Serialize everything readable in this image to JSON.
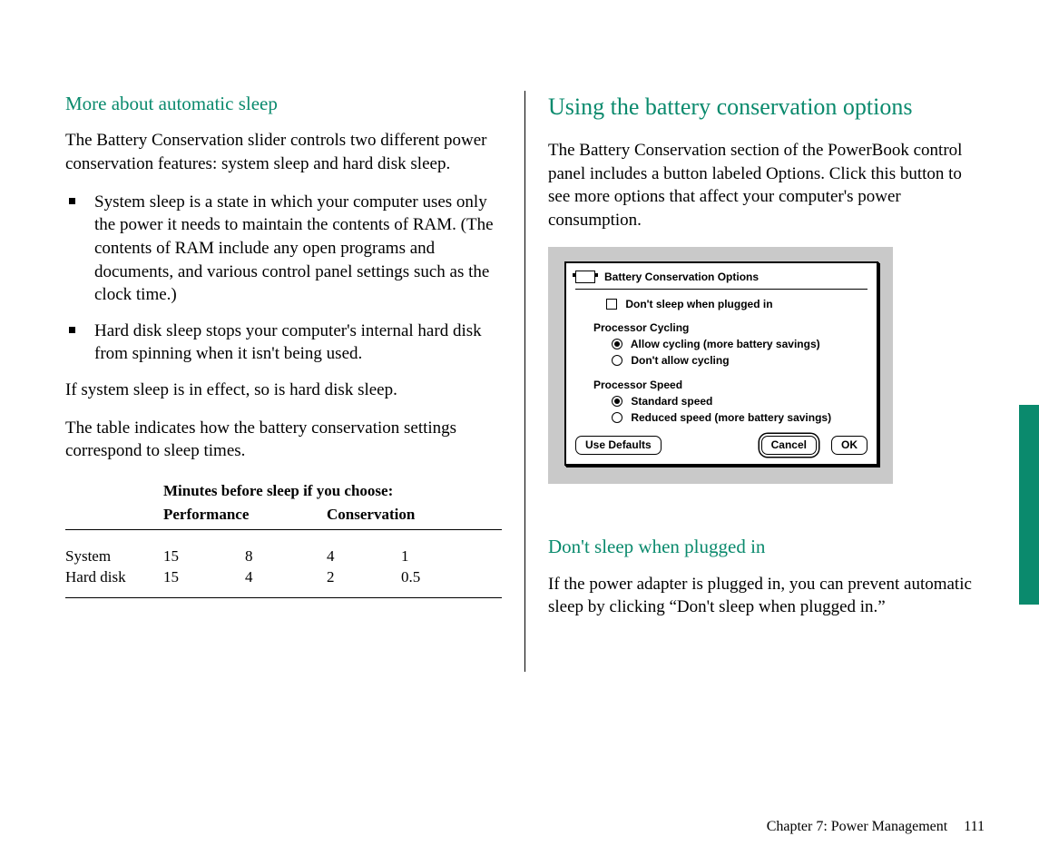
{
  "left": {
    "heading": "More about automatic sleep",
    "intro": "The Battery Conservation slider controls two different power conservation features: system sleep and hard disk sleep.",
    "bullets": [
      "System sleep is a state in which your computer uses only the power it needs to maintain the contents of RAM. (The contents of RAM include any open programs and documents, and various control panel settings such as the clock time.)",
      "Hard disk sleep stops your computer's internal hard disk from spinning when it isn't being used."
    ],
    "after1": "If system sleep is in effect, so is hard disk sleep.",
    "after2": "The table indicates how the battery conservation settings correspond to sleep times."
  },
  "table": {
    "caption": "Minutes before sleep if you choose:",
    "head_left": "Performance",
    "head_right": "Conservation",
    "rows": [
      {
        "label": "System",
        "v": [
          "15",
          "8",
          "4",
          "1"
        ]
      },
      {
        "label": "Hard disk",
        "v": [
          "15",
          "4",
          "2",
          "0.5"
        ]
      }
    ]
  },
  "right": {
    "heading": "Using the battery conservation options",
    "intro": "The Battery Conservation section of the PowerBook control panel includes a button labeled Options. Click this button to see more options that affect your computer's power consumption.",
    "sub_heading": "Don't sleep when plugged in",
    "sub_text": "If the power adapter is plugged in, you can prevent automatic sleep by clicking “Don't sleep when plugged in.”"
  },
  "dialog": {
    "title": "Battery Conservation Options",
    "checkbox": "Don't sleep when plugged in",
    "group1": {
      "label": "Processor Cycling",
      "opt1": "Allow cycling (more battery savings)",
      "opt2": "Don't allow cycling"
    },
    "group2": {
      "label": "Processor Speed",
      "opt1": "Standard speed",
      "opt2": "Reduced speed (more battery savings)"
    },
    "btn_defaults": "Use Defaults",
    "btn_cancel": "Cancel",
    "btn_ok": "OK"
  },
  "chart_data": {
    "type": "table",
    "title": "Minutes before sleep if you choose:",
    "columns": [
      "",
      "Performance",
      "",
      "",
      "Conservation"
    ],
    "rows": [
      [
        "System",
        15,
        8,
        4,
        1
      ],
      [
        "Hard disk",
        15,
        4,
        2,
        0.5
      ]
    ]
  },
  "footer": {
    "chapter": "Chapter 7: Power Management",
    "page": "111"
  }
}
